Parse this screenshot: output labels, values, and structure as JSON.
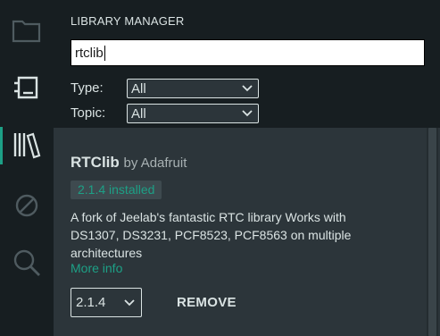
{
  "activity_bar": {
    "items": [
      {
        "icon": "folder-icon"
      },
      {
        "icon": "board-icon"
      },
      {
        "icon": "library-icon",
        "active": true
      },
      {
        "icon": "debug-icon"
      },
      {
        "icon": "search-icon"
      }
    ]
  },
  "library_manager": {
    "title": "LIBRARY MANAGER",
    "search": {
      "value": "rtclib"
    },
    "filters": {
      "type_label": "Type:",
      "type_value": "All",
      "topic_label": "Topic:",
      "topic_value": "All"
    },
    "result": {
      "name": "RTClib",
      "author": "by Adafruit",
      "installed_badge": "2.1.4 installed",
      "description": "A fork of Jeelab's fantastic RTC library Works with DS1307, DS3231, PCF8523, PCF8563 on multiple architectures",
      "more_info": "More info",
      "version": "2.1.4",
      "remove_label": "REMOVE"
    }
  },
  "colors": {
    "background": "#171e21",
    "panel": "#2c353a",
    "accent": "#1da086",
    "text": "#dae3e3"
  }
}
